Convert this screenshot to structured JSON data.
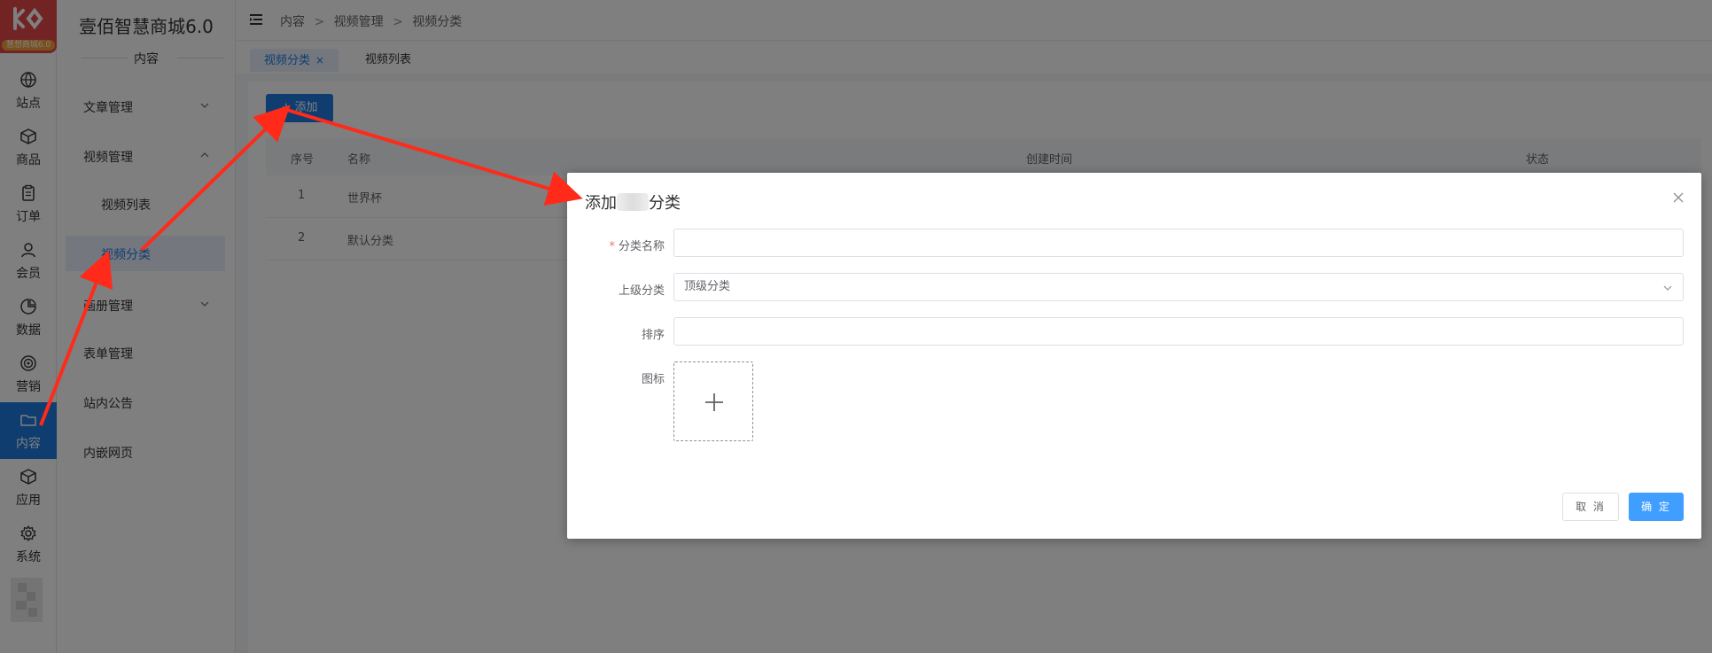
{
  "app": {
    "logo_tag": "慧想商城6.0",
    "brand": "壹佰智慧商城6.0",
    "accent": "#1e7ae0",
    "annotation_color": "#ff2a1a"
  },
  "rail": [
    {
      "key": "site",
      "label": "站点",
      "icon": "globe-icon"
    },
    {
      "key": "goods",
      "label": "商品",
      "icon": "box-icon"
    },
    {
      "key": "order",
      "label": "订单",
      "icon": "clipboard-icon"
    },
    {
      "key": "member",
      "label": "会员",
      "icon": "user-icon"
    },
    {
      "key": "data",
      "label": "数据",
      "icon": "pie-chart-icon"
    },
    {
      "key": "marketing",
      "label": "营销",
      "icon": "target-icon"
    },
    {
      "key": "content",
      "label": "内容",
      "icon": "folder-icon",
      "active": true
    },
    {
      "key": "apps",
      "label": "应用",
      "icon": "cube-icon"
    },
    {
      "key": "system",
      "label": "系统",
      "icon": "gear-icon"
    }
  ],
  "subnav": {
    "section": "内容",
    "items": [
      {
        "label": "文章管理",
        "expandable": true
      },
      {
        "label": "视频管理",
        "expandable": true,
        "expanded": true
      },
      {
        "label": "视频列表",
        "child": true
      },
      {
        "label": "视频分类",
        "child": true,
        "active": true
      },
      {
        "label": "画册管理",
        "expandable": true
      },
      {
        "label": "表单管理"
      },
      {
        "label": "站内公告"
      },
      {
        "label": "内嵌网页"
      }
    ]
  },
  "breadcrumb": [
    "内容",
    "视频管理",
    "视频分类"
  ],
  "breadcrumb_sep": ">",
  "tabs": [
    {
      "label": "视频分类",
      "active": true,
      "close": "×"
    },
    {
      "label": "视频列表"
    }
  ],
  "toolbar": {
    "add_label": "添加",
    "add_icon": "+"
  },
  "table": {
    "headers": [
      "序号",
      "名称",
      "创建时间",
      "状态"
    ],
    "rows": [
      {
        "no": "1",
        "name": "世界杯"
      },
      {
        "no": "2",
        "name": "默认分类"
      }
    ]
  },
  "modal": {
    "title_prefix": "添加",
    "title_suffix": "分类",
    "fields": {
      "name_label": "分类名称",
      "name_value": "",
      "parent_label": "上级分类",
      "parent_value": "顶级分类",
      "sort_label": "排序",
      "sort_value": "",
      "icon_label": "图标"
    },
    "cancel_label": "取 消",
    "ok_label": "确 定"
  }
}
